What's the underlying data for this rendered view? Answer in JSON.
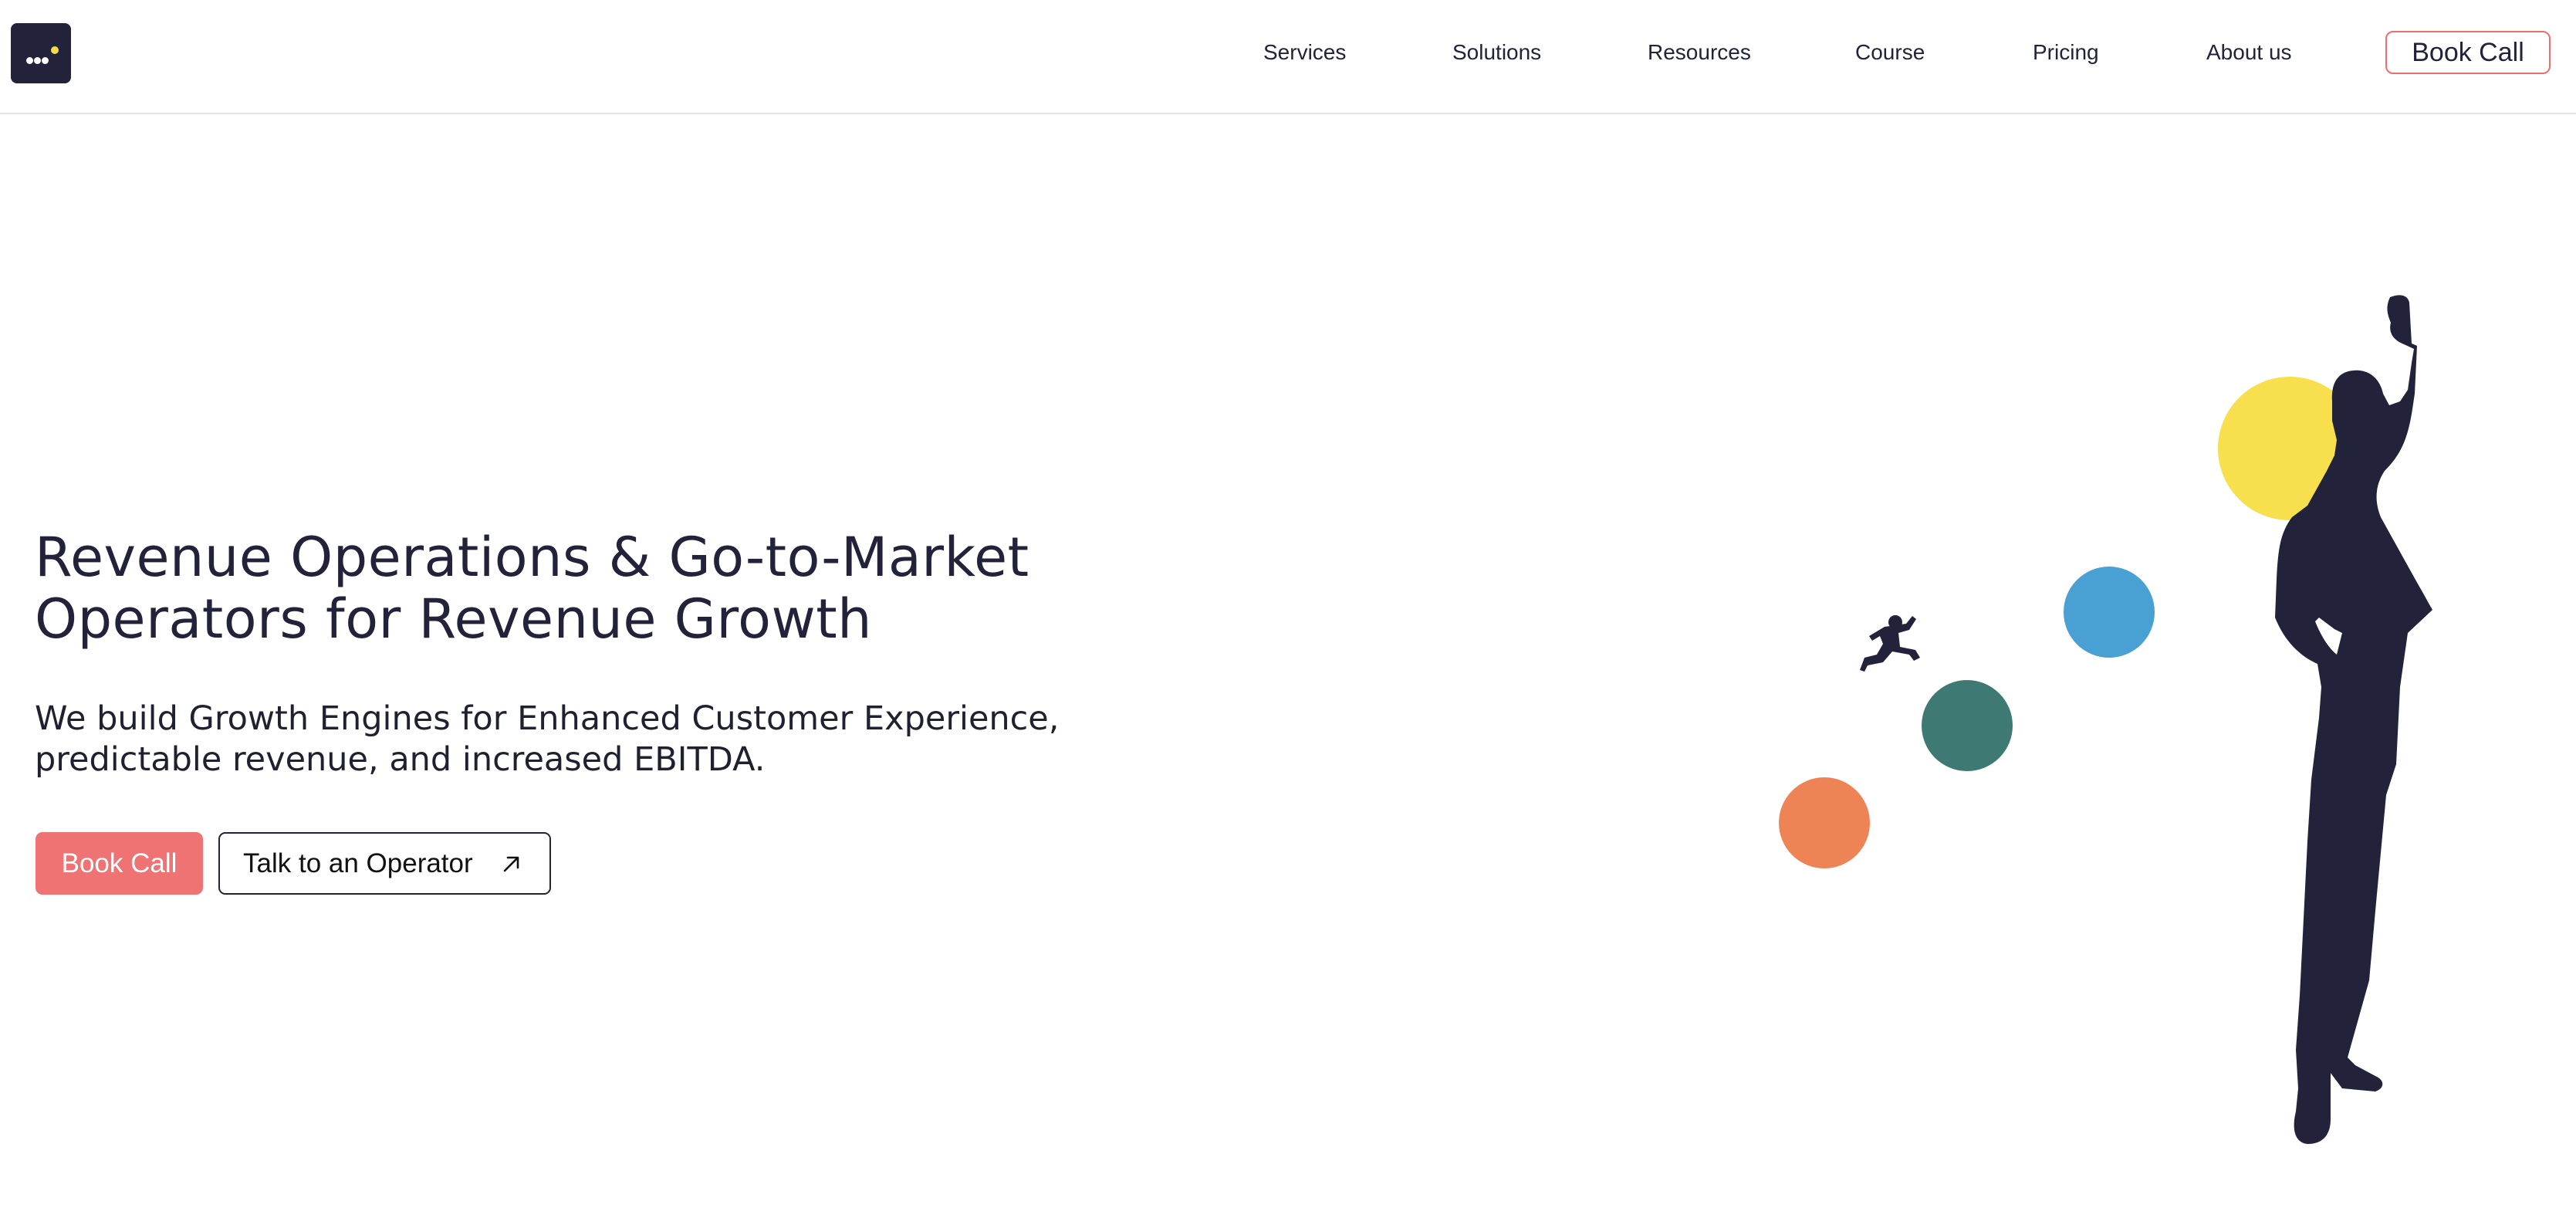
{
  "header": {
    "logo_name": "company-logo",
    "nav": [
      {
        "label": "Services"
      },
      {
        "label": "Solutions"
      },
      {
        "label": "Resources"
      },
      {
        "label": "Course"
      },
      {
        "label": "Pricing"
      },
      {
        "label": "About us"
      }
    ],
    "cta_label": "Book Call"
  },
  "hero": {
    "title_lines": [
      "Revenue Operations & Go-to-Market",
      "Operators for Revenue Growth"
    ],
    "subtitle_lines": [
      "We build Growth Engines for Enhanced Customer Experience,",
      "predictable revenue, and increased EBITDA."
    ],
    "primary_button": "Book Call",
    "secondary_button": "Talk to an Operator",
    "secondary_icon": "arrow-up-right-icon"
  },
  "colors": {
    "brand_dark": "#22233a",
    "accent_coral": "#ef7373",
    "yellow": "#f8df4e",
    "blue": "#48a0d3",
    "teal": "#3e7a73",
    "orange": "#ee8455"
  }
}
